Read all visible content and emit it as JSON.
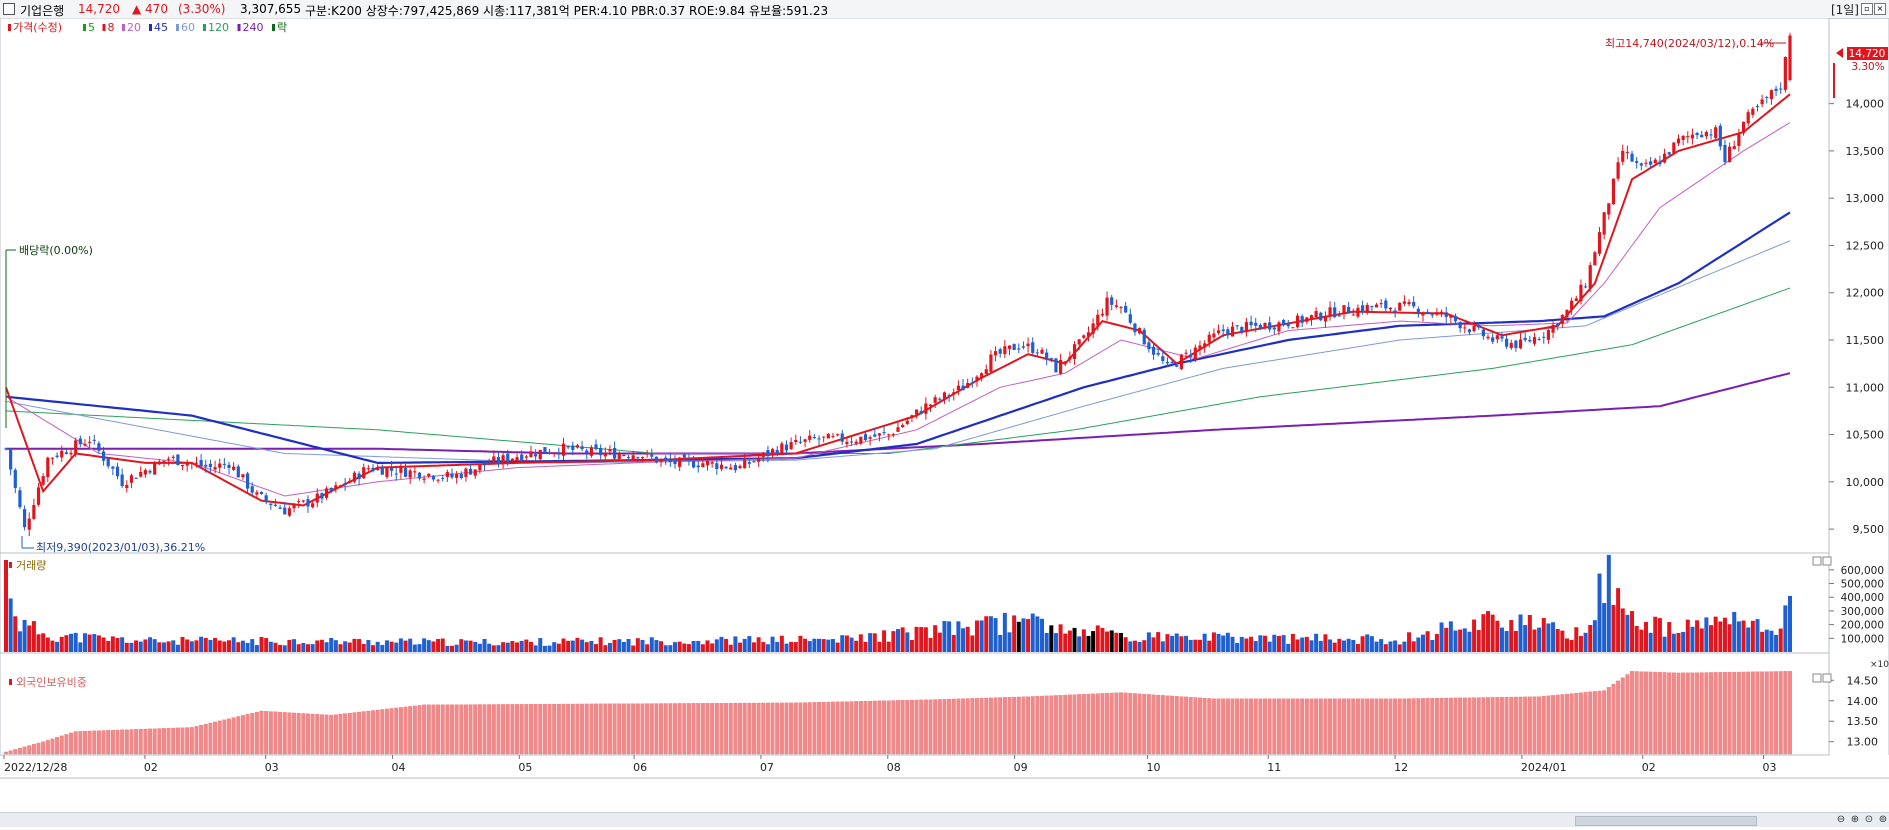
{
  "header": {
    "name": "기업은행",
    "price": "14,720",
    "change": "▲ 470",
    "change_pct": "(3.30%)",
    "volume": "3,307,655",
    "info": "구분:K200  상장수:797,425,869  시총:117,381억  PER:4.10  PBR:0.37  ROE:9.84  유보율:591.23",
    "period": "[1일]"
  },
  "price_panel": {
    "legend": [
      {
        "label": "가격(수정)",
        "color": "#e0161f"
      },
      {
        "label": "5",
        "color": "#13a313"
      },
      {
        "label": "8",
        "color": "#e0161f"
      },
      {
        "label": "20",
        "color": "#c060c0"
      },
      {
        "label": "45",
        "color": "#1f2fc0"
      },
      {
        "label": "60",
        "color": "#7f9ad8"
      },
      {
        "label": "120",
        "color": "#2aa05a"
      },
      {
        "label": "240",
        "color": "#7a1fb0"
      },
      {
        "label": "락",
        "color": "#0a6a1a"
      }
    ],
    "dividend_label": "배당락(0.00%)",
    "low_label": "최저9,390(2023/01/03),36.21%",
    "high_label": "최고14,740(2024/03/12),0.14%",
    "current_price_tag": "14,720",
    "current_pct_tag": "3.30%"
  },
  "volume_panel": {
    "title": "거래량",
    "unit": "×10"
  },
  "foreign_panel": {
    "title": "외국인보유비중"
  },
  "colors": {
    "up": "#e0161f",
    "down": "#1f5fd0",
    "ma240": "#7a1fb0",
    "ma45": "#1f2fc0"
  },
  "chart_data": {
    "type": "candlestick",
    "ylim": [
      9300,
      14800
    ],
    "yticks": [
      "9,500",
      "10,000",
      "10,500",
      "11,000",
      "11,500",
      "12,000",
      "12,500",
      "13,000",
      "13,500",
      "14,000"
    ],
    "volume_ylim": [
      0,
      650000
    ],
    "volume_ticks": [
      "100,000",
      "200,000",
      "300,000",
      "400,000",
      "500,000",
      "600,000"
    ],
    "foreign_ylim": [
      12.7,
      14.8
    ],
    "foreign_ticks": [
      "13.00",
      "13.50",
      "14.00",
      "14.50"
    ],
    "x_labels": [
      "2022/12/28",
      "02",
      "03",
      "04",
      "05",
      "06",
      "07",
      "08",
      "09",
      "10",
      "11",
      "12",
      "2024/01",
      "02",
      "03"
    ],
    "close_anchors": [
      [
        0,
        10350
      ],
      [
        4,
        9500
      ],
      [
        9,
        10250
      ],
      [
        18,
        10450
      ],
      [
        25,
        10000
      ],
      [
        35,
        10250
      ],
      [
        44,
        10150
      ],
      [
        48,
        10200
      ],
      [
        54,
        9850
      ],
      [
        60,
        9700
      ],
      [
        66,
        9800
      ],
      [
        72,
        9950
      ],
      [
        78,
        10150
      ],
      [
        88,
        10100
      ],
      [
        96,
        10050
      ],
      [
        104,
        10200
      ],
      [
        112,
        10300
      ],
      [
        120,
        10350
      ],
      [
        128,
        10300
      ],
      [
        136,
        10300
      ],
      [
        142,
        10200
      ],
      [
        150,
        10200
      ],
      [
        158,
        10150
      ],
      [
        166,
        10350
      ],
      [
        174,
        10450
      ],
      [
        182,
        10450
      ],
      [
        190,
        10500
      ],
      [
        198,
        10800
      ],
      [
        206,
        11000
      ],
      [
        212,
        11300
      ],
      [
        218,
        11450
      ],
      [
        222,
        11400
      ],
      [
        226,
        11200
      ],
      [
        232,
        11500
      ],
      [
        237,
        11900
      ],
      [
        240,
        11850
      ],
      [
        245,
        11500
      ],
      [
        250,
        11200
      ],
      [
        256,
        11400
      ],
      [
        262,
        11600
      ],
      [
        270,
        11650
      ],
      [
        278,
        11700
      ],
      [
        286,
        11800
      ],
      [
        294,
        11850
      ],
      [
        302,
        11850
      ],
      [
        310,
        11750
      ],
      [
        316,
        11600
      ],
      [
        320,
        11500
      ],
      [
        326,
        11450
      ],
      [
        332,
        11600
      ],
      [
        336,
        11800
      ],
      [
        340,
        12100
      ],
      [
        344,
        12800
      ],
      [
        348,
        13500
      ],
      [
        352,
        13300
      ],
      [
        356,
        13400
      ],
      [
        360,
        13600
      ],
      [
        364,
        13700
      ],
      [
        368,
        13700
      ],
      [
        370,
        13400
      ],
      [
        374,
        13800
      ],
      [
        378,
        14000
      ],
      [
        382,
        14200
      ],
      [
        384,
        14720
      ]
    ],
    "ma_anchors": {
      "ma8": [
        [
          0,
          11000
        ],
        [
          8,
          9900
        ],
        [
          15,
          10300
        ],
        [
          30,
          10200
        ],
        [
          40,
          10200
        ],
        [
          55,
          9800
        ],
        [
          64,
          9750
        ],
        [
          80,
          10150
        ],
        [
          110,
          10200
        ],
        [
          140,
          10230
        ],
        [
          170,
          10300
        ],
        [
          196,
          10700
        ],
        [
          210,
          11100
        ],
        [
          220,
          11350
        ],
        [
          228,
          11250
        ],
        [
          236,
          11700
        ],
        [
          244,
          11600
        ],
        [
          252,
          11250
        ],
        [
          262,
          11550
        ],
        [
          290,
          11800
        ],
        [
          310,
          11780
        ],
        [
          322,
          11550
        ],
        [
          334,
          11650
        ],
        [
          342,
          12100
        ],
        [
          350,
          13200
        ],
        [
          360,
          13500
        ],
        [
          374,
          13700
        ],
        [
          384,
          14100
        ]
      ],
      "ma20": [
        [
          0,
          10900
        ],
        [
          20,
          10300
        ],
        [
          40,
          10200
        ],
        [
          60,
          9850
        ],
        [
          80,
          10000
        ],
        [
          110,
          10150
        ],
        [
          140,
          10210
        ],
        [
          170,
          10250
        ],
        [
          196,
          10550
        ],
        [
          214,
          11000
        ],
        [
          228,
          11150
        ],
        [
          240,
          11500
        ],
        [
          256,
          11300
        ],
        [
          276,
          11600
        ],
        [
          300,
          11700
        ],
        [
          320,
          11650
        ],
        [
          336,
          11680
        ],
        [
          344,
          12100
        ],
        [
          356,
          12900
        ],
        [
          374,
          13500
        ],
        [
          384,
          13800
        ]
      ],
      "ma45": [
        [
          0,
          10900
        ],
        [
          40,
          10700
        ],
        [
          80,
          10200
        ],
        [
          120,
          10220
        ],
        [
          170,
          10250
        ],
        [
          196,
          10400
        ],
        [
          214,
          10700
        ],
        [
          232,
          11000
        ],
        [
          252,
          11250
        ],
        [
          276,
          11500
        ],
        [
          300,
          11650
        ],
        [
          330,
          11700
        ],
        [
          344,
          11750
        ],
        [
          360,
          12100
        ],
        [
          384,
          12850
        ]
      ],
      "ma60": [
        [
          0,
          10850
        ],
        [
          60,
          10300
        ],
        [
          120,
          10200
        ],
        [
          170,
          10230
        ],
        [
          200,
          10350
        ],
        [
          232,
          10800
        ],
        [
          262,
          11200
        ],
        [
          300,
          11500
        ],
        [
          340,
          11650
        ],
        [
          384,
          12550
        ]
      ],
      "ma120": [
        [
          0,
          10750
        ],
        [
          80,
          10550
        ],
        [
          140,
          10300
        ],
        [
          190,
          10300
        ],
        [
          230,
          10550
        ],
        [
          270,
          10900
        ],
        [
          320,
          11200
        ],
        [
          350,
          11450
        ],
        [
          384,
          12050
        ]
      ],
      "ma240": [
        [
          0,
          10350
        ],
        [
          80,
          10350
        ],
        [
          120,
          10300
        ],
        [
          170,
          10300
        ],
        [
          210,
          10400
        ],
        [
          260,
          10550
        ],
        [
          320,
          10700
        ],
        [
          356,
          10800
        ],
        [
          384,
          11150
        ]
      ]
    },
    "volume_anchors": [
      [
        0,
        600000
      ],
      [
        3,
        200000
      ],
      [
        10,
        120000
      ],
      [
        30,
        80000
      ],
      [
        60,
        80000
      ],
      [
        100,
        70000
      ],
      [
        140,
        80000
      ],
      [
        180,
        90000
      ],
      [
        222,
        230000
      ],
      [
        240,
        110000
      ],
      [
        300,
        90000
      ],
      [
        320,
        250000
      ],
      [
        340,
        120000
      ],
      [
        345,
        630000
      ],
      [
        350,
        230000
      ],
      [
        360,
        150000
      ],
      [
        370,
        250000
      ],
      [
        380,
        150000
      ],
      [
        384,
        310000
      ]
    ],
    "foreign_anchors": [
      [
        0,
        12.75
      ],
      [
        8,
        13.0
      ],
      [
        15,
        13.25
      ],
      [
        40,
        13.35
      ],
      [
        55,
        13.75
      ],
      [
        70,
        13.65
      ],
      [
        90,
        13.9
      ],
      [
        120,
        13.92
      ],
      [
        170,
        13.95
      ],
      [
        200,
        14.03
      ],
      [
        220,
        14.1
      ],
      [
        240,
        14.2
      ],
      [
        260,
        14.05
      ],
      [
        300,
        14.05
      ],
      [
        330,
        14.1
      ],
      [
        344,
        14.25
      ],
      [
        350,
        14.72
      ],
      [
        360,
        14.68
      ],
      [
        384,
        14.72
      ]
    ],
    "candles": 385
  }
}
